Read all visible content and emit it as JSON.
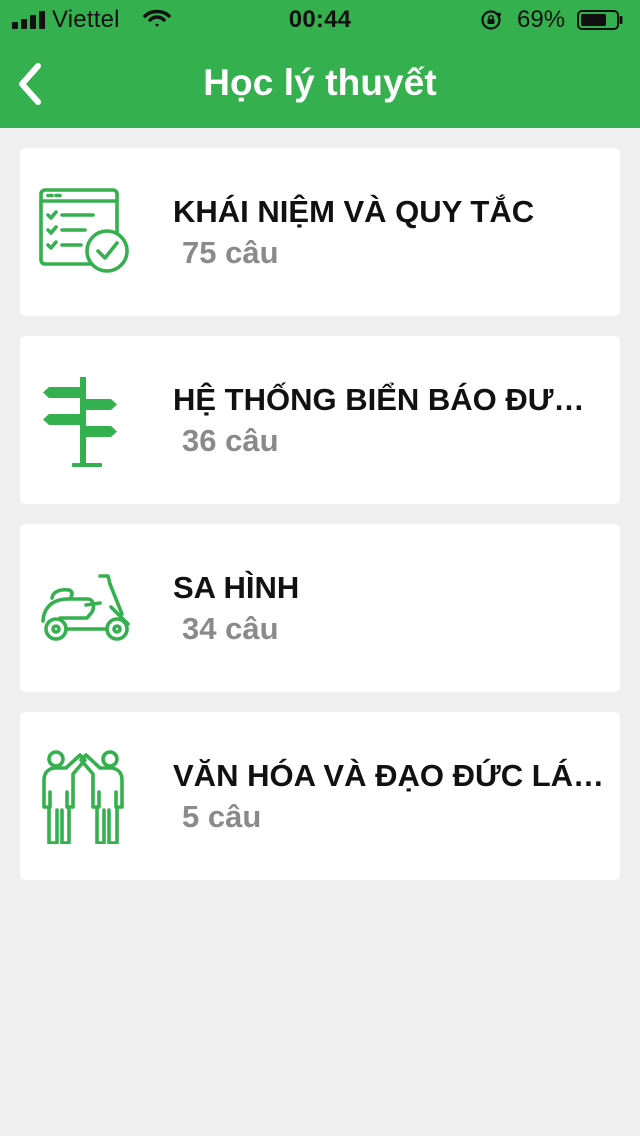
{
  "status_bar": {
    "carrier": "Viettel",
    "time": "00:44",
    "battery": "69%"
  },
  "header": {
    "title": "Học lý thuyết"
  },
  "topics": [
    {
      "title": "KHÁI NIỆM VÀ QUY TẮC",
      "count": "75 câu",
      "icon": "checklist-icon"
    },
    {
      "title": "HỆ THỐNG BIỂN BÁO ĐƯỜ...",
      "count": "36 câu",
      "icon": "signpost-icon"
    },
    {
      "title": "SA HÌNH",
      "count": "34 câu",
      "icon": "motorbike-icon"
    },
    {
      "title": "VĂN HÓA VÀ ĐẠO ĐỨC LÁI...",
      "count": "5 câu",
      "icon": "people-icon"
    }
  ],
  "colors": {
    "brand": "#35b04e",
    "background": "#efefef",
    "card": "#ffffff",
    "title_text": "#111111",
    "sub_text": "#8a8a8a"
  }
}
